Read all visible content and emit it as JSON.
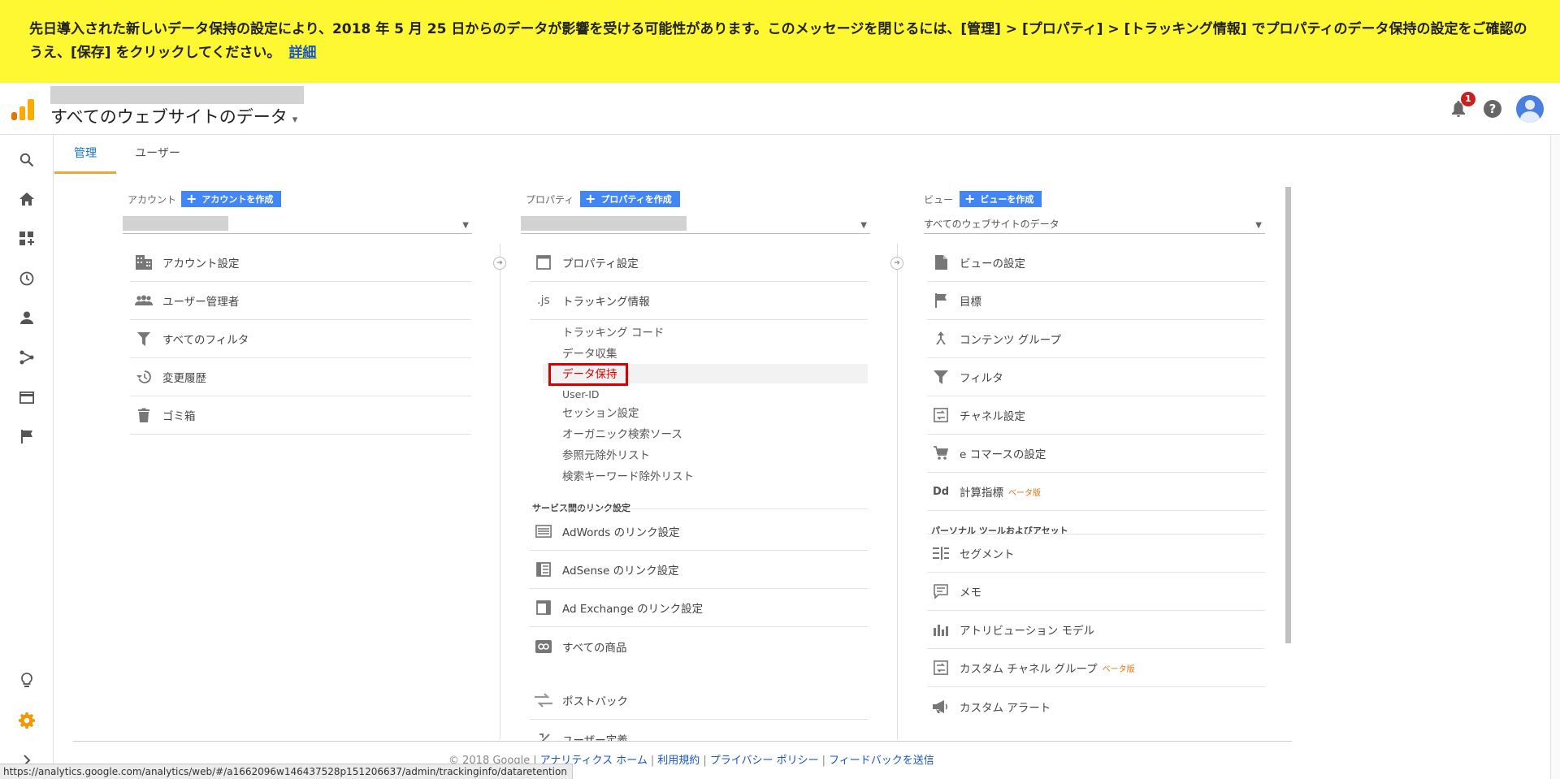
{
  "banner": {
    "message": "先日導入された新しいデータ保持の設定により、2018 年 5 月 25 日からのデータが影響を受ける可能性があります。このメッセージを閉じるには、[管理] > [プロパティ] > [トラッキング情報] でプロパティのデータ保持の設定をご確認のうえ、[保存] をクリックしてください。",
    "link": "詳細"
  },
  "header": {
    "view_title": "すべてのウェブサイトのデータ",
    "caret": "▾",
    "notification_count": "1",
    "help": "?"
  },
  "tabs": [
    {
      "label": "管理",
      "active": true
    },
    {
      "label": "ユーザー",
      "active": false
    }
  ],
  "account": {
    "heading": "アカウント",
    "create": "アカウントを作成",
    "items": [
      "アカウント設定",
      "ユーザー管理者",
      "すべてのフィルタ",
      "変更履歴",
      "ゴミ箱"
    ]
  },
  "property": {
    "heading": "プロパティ",
    "create": "プロパティを作成",
    "items": [
      "プロパティ設定",
      "トラッキング情報"
    ],
    "tracking_icon": ".js",
    "tracking_sub": [
      "トラッキング コード",
      "データ収集",
      "データ保持",
      "User-ID",
      "セッション設定",
      "オーガニック検索ソース",
      "参照元除外リスト",
      "検索キーワード除外リスト"
    ],
    "link_section": "サービス間のリンク設定",
    "link_items": [
      "AdWords のリンク設定",
      "AdSense のリンク設定",
      "Ad Exchange のリンク設定",
      "すべての商品",
      "ポストバック",
      "ユーザー定義"
    ]
  },
  "view": {
    "heading": "ビュー",
    "create": "ビューを作成",
    "selected": "すべてのウェブサイトのデータ",
    "items": [
      "ビューの設定",
      "目標",
      "コンテンツ グループ",
      "フィルタ",
      "チャネル設定",
      "e コマースの設定",
      "計算指標"
    ],
    "calc_icon": "Dd",
    "personal_section": "パーソナル ツールおよびアセット",
    "personal_items": [
      "セグメント",
      "メモ",
      "アトリビューション モデル",
      "カスタム チャネル グループ",
      "カスタム アラート"
    ],
    "beta": "ベータ版"
  },
  "footer": {
    "copyright": "© 2018 Google",
    "links": [
      "アナリティクス ホーム",
      "利用規約",
      "プライバシー ポリシー",
      "フィードバックを送信"
    ],
    "separator": "|"
  },
  "status_url": "https://analytics.google.com/analytics/web/#/a1662096w146437528p151206637/admin/trackinginfo/dataretention",
  "colors": {
    "banner": "#fef832",
    "accent_blue": "#4285f4",
    "highlight_red": "#d60000",
    "settings_orange": "#f29900"
  }
}
